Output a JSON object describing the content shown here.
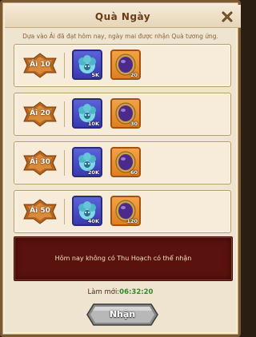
{
  "dialog": {
    "title": "Quà Ngày",
    "subtitle": "Dựa vào Ải đã đạt hôm nay, ngày mai được nhận Quà tương ứng."
  },
  "rows": [
    {
      "stage": "Ải 10",
      "items": [
        {
          "icon": "flower-monster-icon",
          "qty": "5K"
        },
        {
          "icon": "purple-gem-icon",
          "qty": "20"
        }
      ]
    },
    {
      "stage": "Ải 20",
      "items": [
        {
          "icon": "flower-monster-icon",
          "qty": "10K"
        },
        {
          "icon": "purple-gem-icon",
          "qty": "30"
        }
      ]
    },
    {
      "stage": "Ải 30",
      "items": [
        {
          "icon": "flower-monster-icon",
          "qty": "20K"
        },
        {
          "icon": "purple-gem-icon",
          "qty": "60"
        }
      ]
    },
    {
      "stage": "Ải 50",
      "items": [
        {
          "icon": "flower-monster-icon",
          "qty": "40K"
        },
        {
          "icon": "purple-gem-icon",
          "qty": "120"
        }
      ]
    }
  ],
  "notice": "Hôm nay không có Thu Hoạch có thể nhận",
  "refresh": {
    "label": "Làm mới:",
    "time": "06:32:20"
  },
  "button": {
    "label": "Nhận"
  },
  "colors": {
    "panel": "#efe4cf",
    "notice_bg": "#5a120e",
    "timer": "#2f8a2a",
    "title": "#6a3b16"
  }
}
